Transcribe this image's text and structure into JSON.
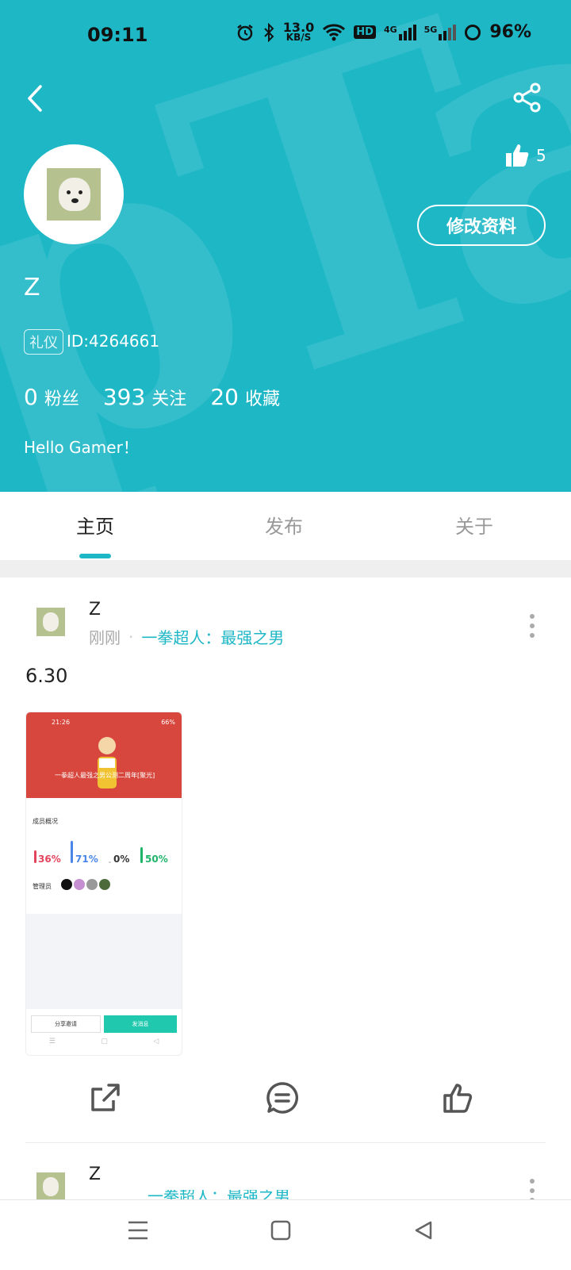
{
  "status_bar": {
    "time": "09:11",
    "net_speed_value": "13.0",
    "net_speed_unit": "KB/S",
    "hd_label": "HD",
    "net_4g": "4G",
    "net_5g": "5G",
    "battery": "96%"
  },
  "profile": {
    "username": "Z",
    "badge": "礼仪",
    "user_id": "ID:4264661",
    "likes": "5",
    "edit_label": "修改资料",
    "bio": "Hello Gamer！",
    "stats": [
      {
        "value": "0",
        "label": "粉丝"
      },
      {
        "value": "393",
        "label": "关注"
      },
      {
        "value": "20",
        "label": "收藏"
      }
    ]
  },
  "tabs": [
    {
      "label": "主页",
      "active": true
    },
    {
      "label": "发布",
      "active": false
    },
    {
      "label": "关于",
      "active": false
    }
  ],
  "post": {
    "author": "Z",
    "time": "刚刚",
    "separator": "·",
    "topic": "一拳超人：最强之男",
    "content": "6.30"
  },
  "thumbnail": {
    "time": "21:26",
    "battery": "66%",
    "title": "一拳超人最强之男公测二周年[聚光]",
    "section1": "成员概况",
    "section2": "管理员",
    "values": [
      {
        "text": "36%",
        "fraction": 0.36,
        "color": "#e2445c"
      },
      {
        "text": "71%",
        "fraction": 0.71,
        "color": "#4a86e8"
      },
      {
        "text": "0%",
        "fraction": 0.0,
        "color": "#333333"
      },
      {
        "text": "50%",
        "fraction": 0.5,
        "color": "#20b46a"
      }
    ],
    "button1": "分享邀请",
    "button2": "发消息"
  },
  "next_post": {
    "author": "Z"
  },
  "colors": {
    "accent": "#1eb7c6",
    "header_bg": "#1eb7c6",
    "muted_text": "#aaaaaa"
  },
  "icons": [
    "back-icon",
    "share-icon",
    "thumbs-up-icon",
    "comment-icon",
    "more-icon",
    "menu-icon",
    "home-square-icon",
    "back-triangle-icon"
  ]
}
